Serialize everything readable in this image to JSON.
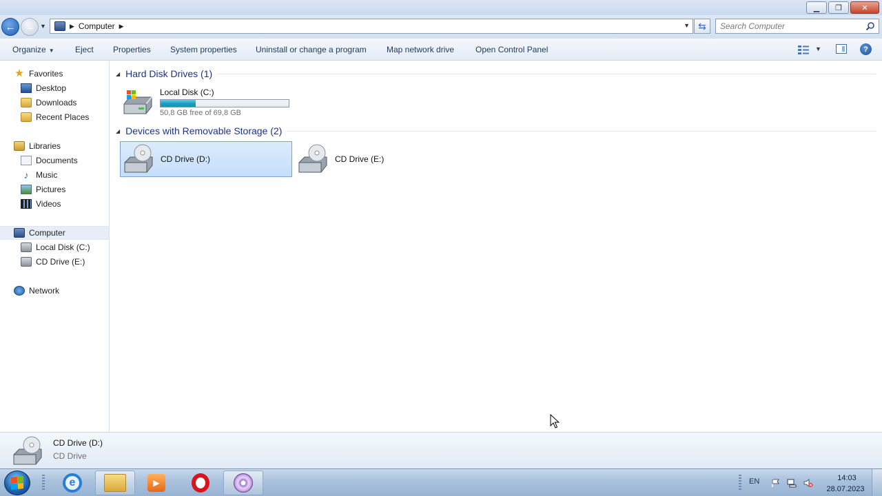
{
  "window": {
    "minimize_label": "▁",
    "maximize_label": "❐",
    "close_label": "✕"
  },
  "address": {
    "path": [
      "Computer"
    ],
    "search_placeholder": "Search Computer"
  },
  "toolbar": {
    "organize": "Organize",
    "eject": "Eject",
    "properties": "Properties",
    "system_properties": "System properties",
    "uninstall": "Uninstall or change a program",
    "map_network_drive": "Map network drive",
    "open_control_panel": "Open Control Panel"
  },
  "navpane": {
    "favorites": {
      "label": "Favorites",
      "items": [
        {
          "label": "Desktop",
          "icon": "desktop-icon"
        },
        {
          "label": "Downloads",
          "icon": "downloads-folder-icon"
        },
        {
          "label": "Recent Places",
          "icon": "recent-places-icon"
        }
      ]
    },
    "libraries": {
      "label": "Libraries",
      "items": [
        {
          "label": "Documents",
          "icon": "documents-icon"
        },
        {
          "label": "Music",
          "icon": "music-icon"
        },
        {
          "label": "Pictures",
          "icon": "pictures-icon"
        },
        {
          "label": "Videos",
          "icon": "videos-icon"
        }
      ]
    },
    "computer": {
      "label": "Computer",
      "items": [
        {
          "label": "Local Disk (C:)",
          "icon": "local-disk-icon"
        },
        {
          "label": "CD Drive (E:)",
          "icon": "cd-drive-icon"
        }
      ]
    },
    "network": {
      "label": "Network"
    }
  },
  "content": {
    "groups": [
      {
        "title": "Hard Disk Drives (1)",
        "items": [
          {
            "name": "Local Disk (C:)",
            "free_text": "50,8 GB free of 69,8 GB",
            "used_fraction": 0.272
          }
        ]
      },
      {
        "title": "Devices with Removable Storage (2)",
        "items": [
          {
            "name": "CD Drive (D:)",
            "selected": true
          },
          {
            "name": "CD Drive (E:)",
            "selected": false
          }
        ]
      }
    ]
  },
  "details": {
    "name": "CD Drive (D:)",
    "type": "CD Drive"
  },
  "taskbar": {
    "language": "EN",
    "time": "14:03",
    "date": "28.07.2023",
    "apps": [
      "internet-explorer-icon",
      "windows-explorer-icon",
      "media-player-icon",
      "opera-icon",
      "disc-burner-icon"
    ]
  }
}
